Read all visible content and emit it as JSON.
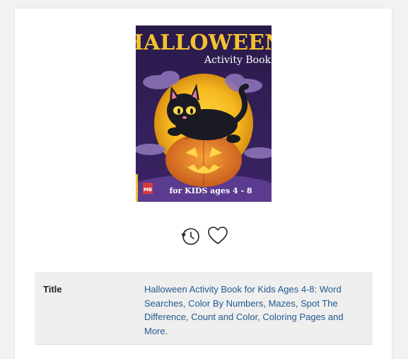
{
  "book": {
    "cover": {
      "title_line1": "HALLOWEEN",
      "title_line2": "Activity Book",
      "tagline": "for KIDS ages 4 - 8",
      "publisher_mark": "MB"
    },
    "actions": {
      "history_icon": "history-clock-icon",
      "favorite_icon": "heart-outline-icon"
    },
    "details": [
      {
        "label": "Title",
        "value": "Halloween Activity Book for Kids Ages 4-8: Word Searches, Color By Numbers, Mazes, Spot The Difference, Count and Color, Coloring Pages and More."
      }
    ]
  },
  "colors": {
    "link": "#22598f",
    "row_bg": "#efefef",
    "cover_title": "#f2c230"
  }
}
